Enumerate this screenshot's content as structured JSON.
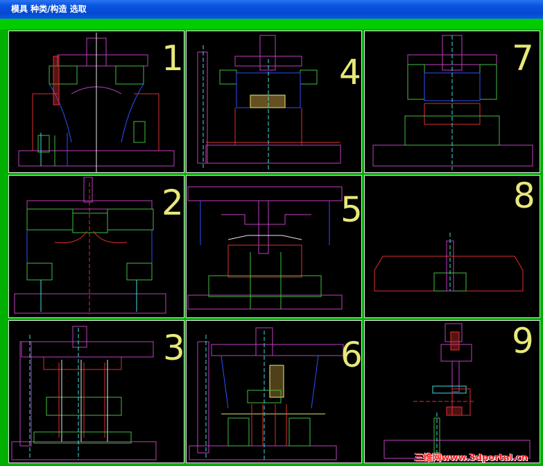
{
  "window": {
    "title": "模具 种类/构造 选取"
  },
  "panels": [
    {
      "id": "1",
      "label": "1"
    },
    {
      "id": "4",
      "label": "4"
    },
    {
      "id": "7",
      "label": "7"
    },
    {
      "id": "2",
      "label": "2"
    },
    {
      "id": "5",
      "label": "5"
    },
    {
      "id": "8",
      "label": "8"
    },
    {
      "id": "3",
      "label": "3"
    },
    {
      "id": "6",
      "label": "6"
    },
    {
      "id": "9",
      "label": "9"
    }
  ],
  "watermark": "三维网www.3dportal.cn",
  "colors": {
    "magenta": "#c040c0",
    "green": "#40c040",
    "blue": "#3050ff",
    "red": "#e03030",
    "cyan": "#40e0e0",
    "yellow": "#e8e87a",
    "background": "#00b000"
  }
}
